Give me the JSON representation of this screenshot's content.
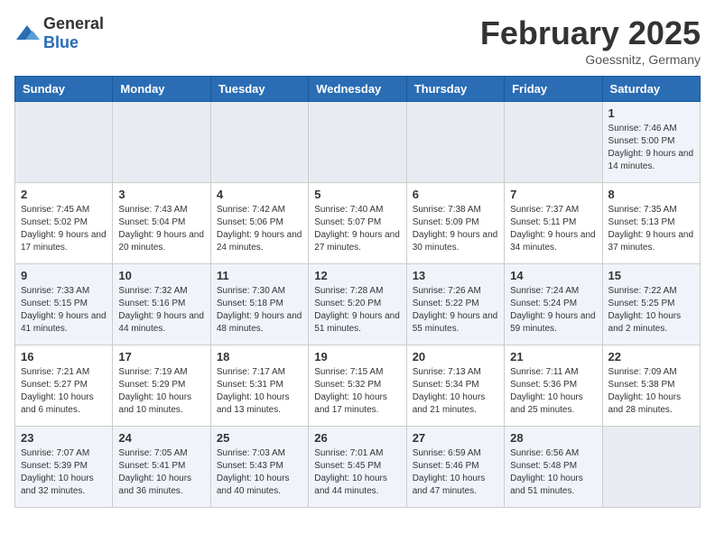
{
  "header": {
    "logo": {
      "general": "General",
      "blue": "Blue"
    },
    "month": "February 2025",
    "location": "Goessnitz, Germany"
  },
  "weekdays": [
    "Sunday",
    "Monday",
    "Tuesday",
    "Wednesday",
    "Thursday",
    "Friday",
    "Saturday"
  ],
  "weeks": [
    [
      {
        "day": "",
        "info": ""
      },
      {
        "day": "",
        "info": ""
      },
      {
        "day": "",
        "info": ""
      },
      {
        "day": "",
        "info": ""
      },
      {
        "day": "",
        "info": ""
      },
      {
        "day": "",
        "info": ""
      },
      {
        "day": "1",
        "info": "Sunrise: 7:46 AM\nSunset: 5:00 PM\nDaylight: 9 hours and 14 minutes."
      }
    ],
    [
      {
        "day": "2",
        "info": "Sunrise: 7:45 AM\nSunset: 5:02 PM\nDaylight: 9 hours and 17 minutes."
      },
      {
        "day": "3",
        "info": "Sunrise: 7:43 AM\nSunset: 5:04 PM\nDaylight: 9 hours and 20 minutes."
      },
      {
        "day": "4",
        "info": "Sunrise: 7:42 AM\nSunset: 5:06 PM\nDaylight: 9 hours and 24 minutes."
      },
      {
        "day": "5",
        "info": "Sunrise: 7:40 AM\nSunset: 5:07 PM\nDaylight: 9 hours and 27 minutes."
      },
      {
        "day": "6",
        "info": "Sunrise: 7:38 AM\nSunset: 5:09 PM\nDaylight: 9 hours and 30 minutes."
      },
      {
        "day": "7",
        "info": "Sunrise: 7:37 AM\nSunset: 5:11 PM\nDaylight: 9 hours and 34 minutes."
      },
      {
        "day": "8",
        "info": "Sunrise: 7:35 AM\nSunset: 5:13 PM\nDaylight: 9 hours and 37 minutes."
      }
    ],
    [
      {
        "day": "9",
        "info": "Sunrise: 7:33 AM\nSunset: 5:15 PM\nDaylight: 9 hours and 41 minutes."
      },
      {
        "day": "10",
        "info": "Sunrise: 7:32 AM\nSunset: 5:16 PM\nDaylight: 9 hours and 44 minutes."
      },
      {
        "day": "11",
        "info": "Sunrise: 7:30 AM\nSunset: 5:18 PM\nDaylight: 9 hours and 48 minutes."
      },
      {
        "day": "12",
        "info": "Sunrise: 7:28 AM\nSunset: 5:20 PM\nDaylight: 9 hours and 51 minutes."
      },
      {
        "day": "13",
        "info": "Sunrise: 7:26 AM\nSunset: 5:22 PM\nDaylight: 9 hours and 55 minutes."
      },
      {
        "day": "14",
        "info": "Sunrise: 7:24 AM\nSunset: 5:24 PM\nDaylight: 9 hours and 59 minutes."
      },
      {
        "day": "15",
        "info": "Sunrise: 7:22 AM\nSunset: 5:25 PM\nDaylight: 10 hours and 2 minutes."
      }
    ],
    [
      {
        "day": "16",
        "info": "Sunrise: 7:21 AM\nSunset: 5:27 PM\nDaylight: 10 hours and 6 minutes."
      },
      {
        "day": "17",
        "info": "Sunrise: 7:19 AM\nSunset: 5:29 PM\nDaylight: 10 hours and 10 minutes."
      },
      {
        "day": "18",
        "info": "Sunrise: 7:17 AM\nSunset: 5:31 PM\nDaylight: 10 hours and 13 minutes."
      },
      {
        "day": "19",
        "info": "Sunrise: 7:15 AM\nSunset: 5:32 PM\nDaylight: 10 hours and 17 minutes."
      },
      {
        "day": "20",
        "info": "Sunrise: 7:13 AM\nSunset: 5:34 PM\nDaylight: 10 hours and 21 minutes."
      },
      {
        "day": "21",
        "info": "Sunrise: 7:11 AM\nSunset: 5:36 PM\nDaylight: 10 hours and 25 minutes."
      },
      {
        "day": "22",
        "info": "Sunrise: 7:09 AM\nSunset: 5:38 PM\nDaylight: 10 hours and 28 minutes."
      }
    ],
    [
      {
        "day": "23",
        "info": "Sunrise: 7:07 AM\nSunset: 5:39 PM\nDaylight: 10 hours and 32 minutes."
      },
      {
        "day": "24",
        "info": "Sunrise: 7:05 AM\nSunset: 5:41 PM\nDaylight: 10 hours and 36 minutes."
      },
      {
        "day": "25",
        "info": "Sunrise: 7:03 AM\nSunset: 5:43 PM\nDaylight: 10 hours and 40 minutes."
      },
      {
        "day": "26",
        "info": "Sunrise: 7:01 AM\nSunset: 5:45 PM\nDaylight: 10 hours and 44 minutes."
      },
      {
        "day": "27",
        "info": "Sunrise: 6:59 AM\nSunset: 5:46 PM\nDaylight: 10 hours and 47 minutes."
      },
      {
        "day": "28",
        "info": "Sunrise: 6:56 AM\nSunset: 5:48 PM\nDaylight: 10 hours and 51 minutes."
      },
      {
        "day": "",
        "info": ""
      }
    ]
  ]
}
